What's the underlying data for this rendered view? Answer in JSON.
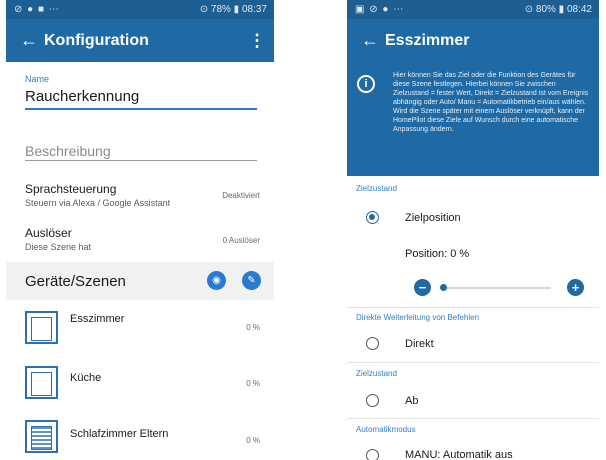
{
  "left": {
    "status": {
      "left_icons": "⊘ ● ■ ⋯",
      "right": "⊙ 78% ▮ 08:37"
    },
    "appbar": {
      "back": "←",
      "title": "Konfiguration",
      "menu": "⋮"
    },
    "name_label": "Name",
    "name_value": "Raucherkennung",
    "description_placeholder": "Beschreibung",
    "voice": {
      "title": "Sprachsteuerung",
      "sub": "Steuern via Alexa / Google Assistant",
      "value": "Deaktiviert"
    },
    "trigger": {
      "title": "Auslöser",
      "sub": "Diese Szene hat",
      "value": "0 Auslöser"
    },
    "devices_title": "Geräte/Szenen",
    "devices": [
      {
        "name": "Esszimmer",
        "pct": "0 %"
      },
      {
        "name": "Küche",
        "pct": "0 %"
      },
      {
        "name": "Schlafzimmer Eltern",
        "pct": "0 %"
      }
    ],
    "colors": {
      "primary": "#1f6aa4",
      "statusbar": "#1d5f93",
      "accent": "#2a7ad0"
    }
  },
  "right": {
    "status": {
      "left_icons": "▣ ⊘ ● ⋯",
      "right": "⊙ 80% ▮ 08:42"
    },
    "appbar": {
      "back": "←",
      "title": "Esszimmer"
    },
    "info_text": "Hier können Sie das Ziel oder die Funktion des Gerätes für diese Szene festlegen. Hierbei können Sie zwischen Zielzustand = fester Wert, Direkt = Zielzustand ist vom Ereignis abhängig oder Auto/ Manu = Automatikbetrieb ein/aus wählen. Wird die Szene später mit einem Auslöser verknüpft, kann der HomePilot diese Ziele auf Wunsch durch eine automatische Anpassung ändern.",
    "section_target": "Zielzustand",
    "option_target": "Zielposition",
    "position_label": "Position: 0 %",
    "slider": {
      "value_percent": 0,
      "minus": "−",
      "plus": "+"
    },
    "section_direct": "Direkte Weiterleitung von Befehlen",
    "option_direct": "Direkt",
    "section_state": "Zielzustand",
    "option_state": "Ab",
    "section_auto": "Automatikmodus",
    "option_auto": "MANU: Automatik aus"
  }
}
